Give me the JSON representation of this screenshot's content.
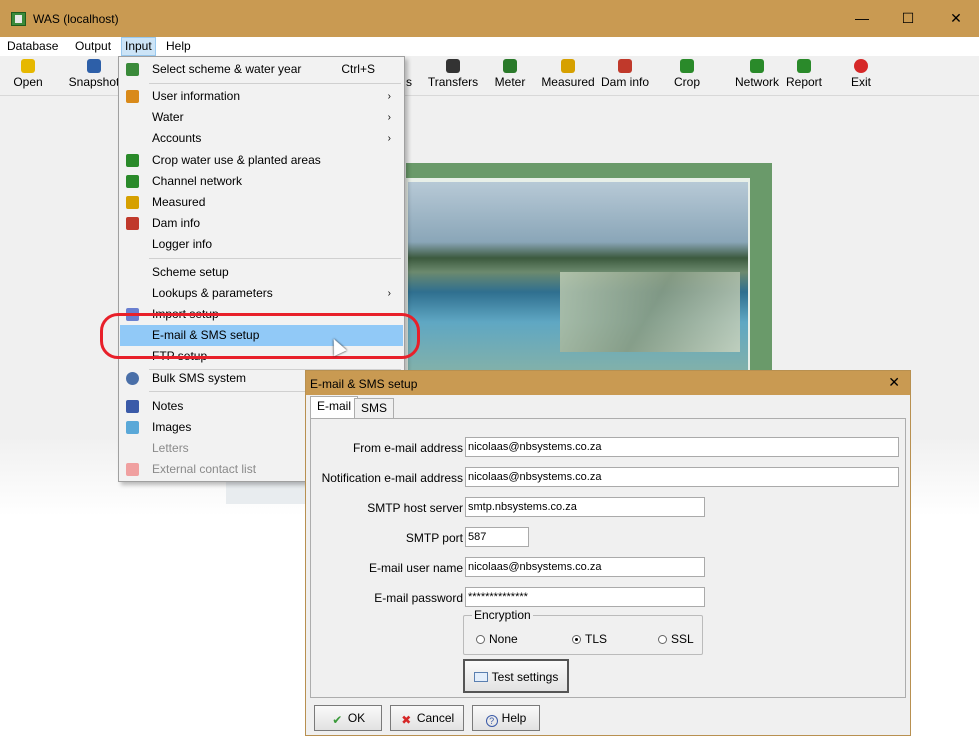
{
  "window": {
    "title": "WAS (localhost)",
    "minimize": "—",
    "maximize": "☐",
    "close": "✕"
  },
  "menubar": [
    "Database",
    "Output",
    "Input",
    "Help"
  ],
  "toolbar": [
    {
      "label": "Open",
      "icon": "folder-open-icon",
      "color": "#e6b800"
    },
    {
      "label": "Snapshot",
      "icon": "save-icon",
      "color": "#2d5fa8"
    },
    {
      "label": "Transfers",
      "icon": "transfers-icon",
      "color": "#333333"
    },
    {
      "label": "Meter",
      "icon": "meter-icon",
      "color": "#2a7a2a"
    },
    {
      "label": "Measured",
      "icon": "ruler-icon",
      "color": "#d6a000"
    },
    {
      "label": "Dam info",
      "icon": "dam-icon",
      "color": "#c0392b"
    },
    {
      "label": "Crop",
      "icon": "crop-icon",
      "color": "#2a8a2a"
    },
    {
      "label": "Network",
      "icon": "network-icon",
      "color": "#2a8a2a"
    },
    {
      "label": "Report",
      "icon": "report-icon",
      "color": "#2a8a2a"
    },
    {
      "label": "Exit",
      "icon": "exit-icon",
      "color": "#d62828"
    }
  ],
  "toolbar_partial": "s",
  "input_menu": [
    {
      "label": "Select scheme & water year",
      "shortcut": "Ctrl+S",
      "icon": "scheme-icon"
    },
    {
      "label": "User information",
      "submenu": "›",
      "icon": "users-icon"
    },
    {
      "label": "Water",
      "submenu": "›"
    },
    {
      "label": "Accounts",
      "submenu": "›"
    },
    {
      "label": "Crop water use & planted areas",
      "icon": "crop-icon"
    },
    {
      "label": "Channel network",
      "icon": "network-icon"
    },
    {
      "label": "Measured",
      "icon": "ruler-icon"
    },
    {
      "label": "Dam info",
      "icon": "dam-icon"
    },
    {
      "label": "Logger info"
    },
    {
      "label": "Scheme setup"
    },
    {
      "label": "Lookups & parameters",
      "submenu": "›"
    },
    {
      "label": "Import setup",
      "icon": "import-icon"
    },
    {
      "label": "E-mail & SMS setup"
    },
    {
      "label": "FTP setup"
    },
    {
      "label": "Bulk SMS system",
      "icon": "sms-icon"
    },
    {
      "label": "Notes",
      "icon": "notes-icon"
    },
    {
      "label": "Images",
      "icon": "images-icon"
    },
    {
      "label": "Letters"
    },
    {
      "label": "External contact list",
      "icon": "phone-icon"
    }
  ],
  "dialog": {
    "title": "E-mail & SMS setup",
    "close": "✕",
    "tabs": [
      "E-mail",
      "SMS"
    ],
    "fields": [
      {
        "label": "From e-mail address",
        "value": "nicolaas@nbsystems.co.za"
      },
      {
        "label": "Notification e-mail address",
        "value": "nicolaas@nbsystems.co.za"
      },
      {
        "label": "SMTP host server",
        "value": "smtp.nbsystems.co.za"
      },
      {
        "label": "SMTP port",
        "value": "587"
      },
      {
        "label": "E-mail user name",
        "value": "nicolaas@nbsystems.co.za"
      },
      {
        "label": "E-mail password",
        "value": "**************"
      }
    ],
    "encryption": {
      "legend": "Encryption",
      "options": [
        "None",
        "TLS",
        "SSL"
      ],
      "selected": "TLS"
    },
    "test_button": "Test settings",
    "footer": [
      "OK",
      "Cancel",
      "Help"
    ]
  }
}
